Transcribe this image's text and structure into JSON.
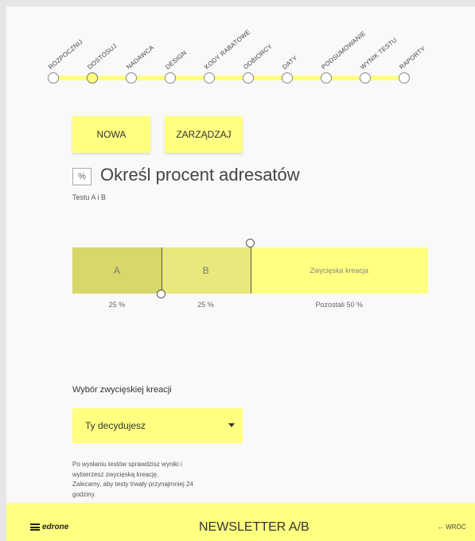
{
  "wizard": {
    "steps": [
      {
        "label": "ROZPOCZNIJ",
        "active": false
      },
      {
        "label": "DOSTOSUJ",
        "active": true
      },
      {
        "label": "NADAWCA",
        "active": false
      },
      {
        "label": "DESIGN",
        "active": false
      },
      {
        "label": "KODY RABATOWE",
        "active": false
      },
      {
        "label": "ODBIORCY",
        "active": false
      },
      {
        "label": "DATY",
        "active": false
      },
      {
        "label": "PODSUMOWANIE",
        "active": false
      },
      {
        "label": "WYNIK TESTU",
        "active": false
      },
      {
        "label": "RAPORTY",
        "active": false
      }
    ]
  },
  "buttons": {
    "new_label": "NOWA",
    "manage_label": "ZARZĄDZAJ"
  },
  "heading": {
    "icon_glyph": "%",
    "title": "Określ procent adresatów",
    "subtitle": "Testu A i B"
  },
  "split": {
    "a": {
      "label": "A",
      "percent": 25,
      "caption": "25 %"
    },
    "b": {
      "label": "B",
      "percent": 25,
      "caption": "25 %"
    },
    "rest": {
      "label": "Zwycięska kreacja",
      "percent": 50,
      "caption": "Pozostali 50 %"
    },
    "colors": {
      "a": "#d7d76a",
      "b": "#e8e87c",
      "rest": "#ffff80"
    }
  },
  "winner": {
    "label": "Wybór zwycięskiej kreacji",
    "selected": "Ty decydujesz",
    "note": [
      "Po wysłaniu testów sprawdzisz wyniki i",
      "wybierzesz zwycięską kreację.",
      "Zalecamy, aby testy trwały przynajmniej 24",
      "godziny."
    ]
  },
  "footer": {
    "brand": "edrone",
    "title": "NEWSLETTER A/B",
    "back": "← WRÓĆ"
  },
  "theme": {
    "accent": "#ffff80"
  }
}
